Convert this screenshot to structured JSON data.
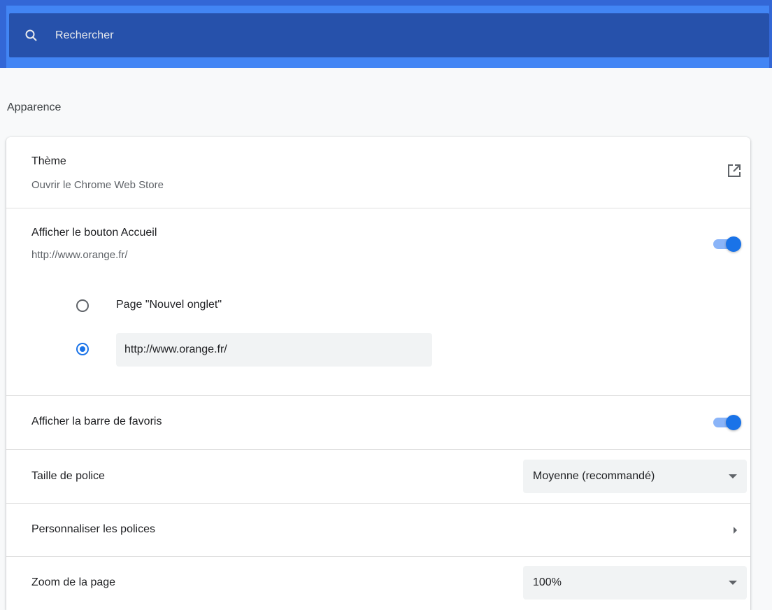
{
  "search": {
    "placeholder": "Rechercher"
  },
  "section": {
    "title": "Apparence"
  },
  "theme": {
    "label": "Thème",
    "sublabel": "Ouvrir le Chrome Web Store"
  },
  "home_button": {
    "label": "Afficher le bouton Accueil",
    "sublabel": "http://www.orange.fr/",
    "enabled": true,
    "options": [
      {
        "label": "Page \"Nouvel onglet\"",
        "selected": false
      },
      {
        "value": "http://www.orange.fr/",
        "selected": true
      }
    ]
  },
  "bookmarks_bar": {
    "label": "Afficher la barre de favoris",
    "enabled": true
  },
  "font_size": {
    "label": "Taille de police",
    "selected": "Moyenne (recommandé)"
  },
  "customize_fonts": {
    "label": "Personnaliser les polices"
  },
  "page_zoom": {
    "label": "Zoom de la page",
    "selected": "100%"
  },
  "colors": {
    "header_blue": "#3367d6",
    "search_bg": "#2651ab",
    "accent": "#1a73e8",
    "toggle_track": "#8ab4f8"
  }
}
